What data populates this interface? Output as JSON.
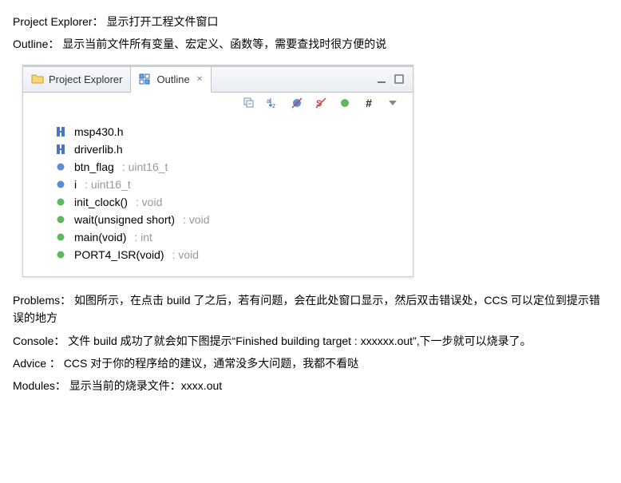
{
  "descriptions": {
    "project_explorer": {
      "label": "Project Explorer：",
      "text": "显示打开工程文件窗口"
    },
    "outline": {
      "label": "Outline：",
      "text": "显示当前文件所有变量、宏定义、函数等，需要查找时很方便的说"
    },
    "problems": {
      "label": "Problems：",
      "text": "如图所示，在点击 build 了之后，若有问题，会在此处窗口显示，然后双击错误处，CCS 可以定位到提示错误的地方"
    },
    "console": {
      "label": "Console：",
      "text": "文件 build 成功了就会如下图提示“Finished building target : xxxxxx.out”,下一步就可以烧录了。"
    },
    "advice": {
      "label": "Advice ：",
      "text": "CCS 对于你的程序给的建议，通常没多大问题，我都不看哒"
    },
    "modules": {
      "label": "Modules：",
      "text": "显示当前的烧录文件：xxxx.out"
    }
  },
  "panel": {
    "tabs": {
      "project_explorer": "Project Explorer",
      "outline": "Outline"
    },
    "close_glyph": "✕"
  },
  "outline_items": [
    {
      "kind": "include",
      "name": "msp430.h",
      "type": ""
    },
    {
      "kind": "include",
      "name": "driverlib.h",
      "type": ""
    },
    {
      "kind": "field",
      "name": "btn_flag",
      "type": " : uint16_t"
    },
    {
      "kind": "field",
      "name": "i",
      "type": " : uint16_t"
    },
    {
      "kind": "method",
      "name": "init_clock()",
      "type": " : void"
    },
    {
      "kind": "method",
      "name": "wait(unsigned short)",
      "type": " : void"
    },
    {
      "kind": "method",
      "name": "main(void)",
      "type": " : int"
    },
    {
      "kind": "method",
      "name": "PORT4_ISR(void)",
      "type": " : void"
    }
  ]
}
